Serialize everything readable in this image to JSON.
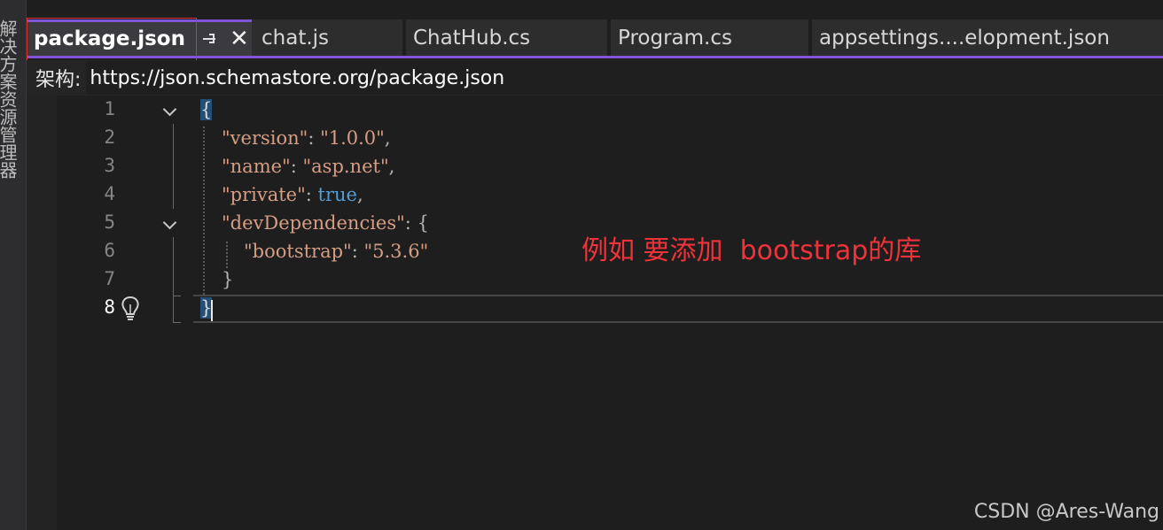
{
  "left_strip": {
    "label": "解决方案资源管理器"
  },
  "tabs": [
    {
      "label": "package.json",
      "active": true
    },
    {
      "label": "chat.js",
      "active": false
    },
    {
      "label": "ChatHub.cs",
      "active": false
    },
    {
      "label": "Program.cs",
      "active": false
    },
    {
      "label": "appsettings....elopment.json",
      "active": false
    }
  ],
  "schema_bar": {
    "label": "架构:",
    "url": "https://json.schemastore.org/package.json"
  },
  "editor": {
    "line_numbers": [
      "1",
      "2",
      "3",
      "4",
      "5",
      "6",
      "7",
      "8"
    ],
    "current_line": "8",
    "code": {
      "l1_open": "{",
      "l2_key": "\"version\"",
      "l2_colon": ": ",
      "l2_val": "\"1.0.0\"",
      "l2_comma": ",",
      "l3_key": "\"name\"",
      "l3_colon": ": ",
      "l3_val": "\"asp.net\"",
      "l3_comma": ",",
      "l4_key": "\"private\"",
      "l4_colon": ": ",
      "l4_val": "true",
      "l4_comma": ",",
      "l5_key": "\"devDependencies\"",
      "l5_colon": ": ",
      "l5_open": "{",
      "l6_key": "\"bootstrap\"",
      "l6_colon": ": ",
      "l6_val": "\"5.3.6\"",
      "l7_close": "}",
      "l8_close": "}"
    }
  },
  "annotation": "例如 要添加  bootstrap的库",
  "watermark": "CSDN @Ares-Wang",
  "colors": {
    "accent": "#7f56d8",
    "highlight_border": "#e03131",
    "annotation": "#f0323a"
  }
}
